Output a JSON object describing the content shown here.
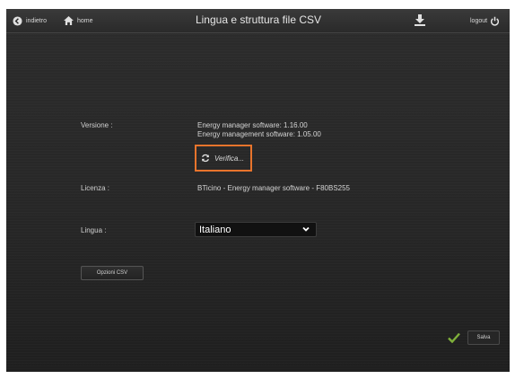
{
  "topbar": {
    "back_label": "indietro",
    "home_label": "home",
    "title": "Lingua e struttura file CSV",
    "logout_label": "logout"
  },
  "version": {
    "label": "Versione :",
    "line1": "Energy manager software: 1.16.00",
    "line2": "Energy management software: 1.05.00",
    "verify_label": "Verifica..."
  },
  "license": {
    "label": "Licenza :",
    "value": "BTicino - Energy manager software - F80BS255"
  },
  "language": {
    "label": "Lingua :",
    "selected": "Italiano"
  },
  "buttons": {
    "csv_options": "Opzioni CSV",
    "save": "Salva"
  },
  "colors": {
    "highlight": "#e8742c",
    "save_check": "#7fb03a",
    "background": "#272727"
  },
  "icons": [
    "back-arrow-icon",
    "home-icon",
    "download-icon",
    "power-icon",
    "refresh-icon",
    "chevron-down-icon",
    "check-icon"
  ]
}
